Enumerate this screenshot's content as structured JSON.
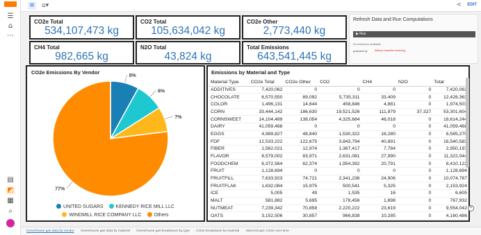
{
  "rail": {
    "icons": [
      "menu-icon",
      "home-icon",
      "more-icon",
      "list-icon",
      "chart-icon",
      "calendar-icon",
      "search-icon",
      "help-icon"
    ]
  },
  "topbar": {
    "edit_label": "EDIT"
  },
  "cards": {
    "co2e_total": {
      "label": "CO2e Total",
      "value": "534,107,473 kg"
    },
    "co2_total": {
      "label": "CO2 Total",
      "value": "105,634,042 kg"
    },
    "co2e_other": {
      "label": "CO2e Other",
      "value": "2,773,440 kg"
    },
    "ch4_total": {
      "label": "CH4 Total",
      "value": "982,665 kg"
    },
    "n2o_total": {
      "label": "N2O Total",
      "value": "43,824 kg"
    },
    "total_emissions": {
      "label": "Total Emissions",
      "value": "643,541,445 kg"
    }
  },
  "run_panel": {
    "title": "Refresh Data and Run Computations",
    "run_label": "▶ Run",
    "status": "No instances available",
    "powered_by": "powered by",
    "brand": "Alteryx machine learning"
  },
  "pie": {
    "title": "CO2e Emissions By Vendor",
    "colors": {
      "UNITED SUGARS": "#1a7fb4",
      "KENNEDY RICE MILL LLC": "#1ec8d0",
      "WINDMILL RICE COMPANY LLC": "#ffb81c",
      "Others": "#ff8c00"
    }
  },
  "chart_data": {
    "type": "pie",
    "title": "CO2e Emissions By Vendor",
    "categories": [
      "UNITED SUGARS",
      "KENNEDY RICE MILL LLC",
      "WINDMILL RICE COMPANY LLC",
      "Others"
    ],
    "values": [
      8,
      8,
      7,
      77
    ],
    "labels": [
      "8%",
      "8%",
      "7%",
      "77%"
    ],
    "legend": "bottom"
  },
  "table": {
    "title": "Emissions by Material and Type",
    "columns": [
      "Material Type",
      "CO2e Total",
      "CO2e Other",
      "CO2",
      "CH4",
      "N2O",
      "Total"
    ],
    "rows": [
      [
        "ADDITIVES",
        "7,420,062",
        "0",
        "0",
        "0",
        "0",
        "7,420,062"
      ],
      [
        "CHOCOLATE",
        "6,570,550",
        "89,092",
        "5,735,311",
        "33,409",
        "0",
        "12,428,363"
      ],
      [
        "COLOR",
        "1,496,131",
        "14,644",
        "458,846",
        "4,881",
        "0",
        "1,974,503"
      ],
      [
        "CORN",
        "33,444,142",
        "186,630",
        "19,521,526",
        "111,979",
        "37,327",
        "53,301,604"
      ],
      [
        "CORNSWEET",
        "14,104,489",
        "138,054",
        "4,325,684",
        "46,018",
        "0",
        "18,614,244"
      ],
      [
        "DAIRY",
        "41,059,468",
        "0",
        "0",
        "0",
        "0",
        "41,059,468"
      ],
      [
        "EGGS",
        "4,989,827",
        "48,840",
        "1,530,322",
        "16,280",
        "0",
        "6,585,270"
      ],
      [
        "FDF",
        "12,533,222",
        "122,675",
        "3,843,794",
        "40,891",
        "0",
        "16,540,583"
      ],
      [
        "FIBER",
        "1,562,021",
        "12,974",
        "1,367,417",
        "7,784",
        "0",
        "2,950,197"
      ],
      [
        "FLAVOR",
        "8,579,002",
        "83,971",
        "2,631,081",
        "27,990",
        "0",
        "11,322,044"
      ],
      [
        "FOODCHEM",
        "6,372,564",
        "62,374",
        "1,954,392",
        "20,791",
        "0",
        "8,410,122"
      ],
      [
        "FRUIT",
        "1,128,694",
        "0",
        "0",
        "0",
        "0",
        "1,128,694"
      ],
      [
        "FRUITFILL",
        "7,633,923",
        "74,721",
        "2,341,236",
        "24,906",
        "0",
        "10,074,787"
      ],
      [
        "FRUITFLAK",
        "1,632,084",
        "15,975",
        "500,541",
        "5,325",
        "0",
        "2,153,924"
      ],
      [
        "ICE",
        "5,005",
        "49",
        "1,535",
        "16",
        "0",
        "6,605"
      ],
      [
        "MALT",
        "581,882",
        "5,695",
        "178,456",
        "1,898",
        "0",
        "767,932"
      ],
      [
        "NUTMEAT",
        "7,239,342",
        "70,858",
        "2,220,222",
        "23,619",
        "0",
        "9,554,042"
      ],
      [
        "OATS",
        "3,152,506",
        "30,857",
        "966,838",
        "10,285",
        "0",
        "4,160,486"
      ]
    ]
  },
  "bottom_tabs": [
    "Greenhouse gas data by vendor",
    "Greenhouse gas data by material",
    "Greenhouse gas breakdown by type",
    "CO2e breakdown by material",
    "Macroscopic CO2e over time"
  ]
}
